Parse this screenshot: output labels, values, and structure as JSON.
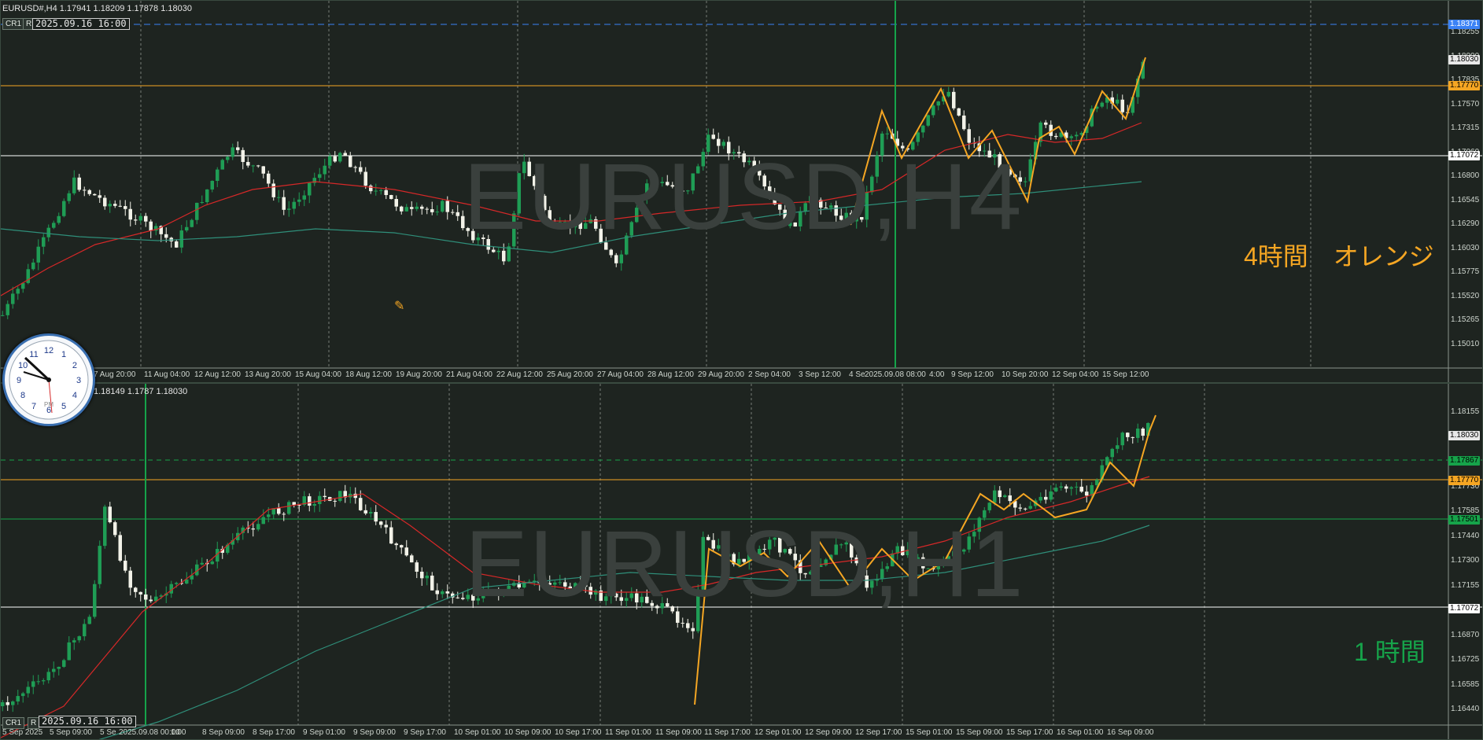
{
  "top_pane": {
    "title": "EURUSD#,H4  1.17941  1.18209  1.17878  1.18030",
    "btn_cr1": "CR1",
    "btn_r": "R",
    "cursor_date": "2025.09.16 16:00",
    "watermark": "EURUSD,H4",
    "overlay_text": "4時間　オレンジ",
    "overlay_color": "#f5a623",
    "x_labels": [
      "7 Aug 20:00",
      "11 Aug 04:00",
      "12 Aug 12:00",
      "13 Aug 20:00",
      "15 Aug 04:00",
      "18 Aug 12:00",
      "19 Aug 20:00",
      "21 Aug 04:00",
      "22 Aug 12:00",
      "25 Aug 20:00",
      "27 Aug 04:00",
      "28 Aug 12:00",
      "29 Aug 20:00",
      "2 Sep 04:00",
      "3 Sep 12:00",
      "4 Se",
      "2025.09.08 08:00",
      "4:00",
      "9 Sep 12:00",
      "10 Sep 20:00",
      "12 Sep 04:00",
      "15 Sep 12:00"
    ],
    "y_labels": [
      "1.18255",
      "1.18000",
      "1.17835",
      "1.17570",
      "1.17315",
      "1.17060",
      "1.16800",
      "1.16545",
      "1.16290",
      "1.16030",
      "1.15775",
      "1.15520",
      "1.15265",
      "1.15010"
    ],
    "price_tags": {
      "blue": "1.18371",
      "current": "1.18030",
      "orange": "1.17770",
      "white": "1.17072"
    }
  },
  "bottom_pane": {
    "title": "1.18149  1.1787  1.18030",
    "btn_cr1": "CR1",
    "btn_r": "R",
    "cursor_date": "2025.09.16 16:00",
    "watermark": "EURUSD,H1",
    "overlay_text": "1 時間",
    "overlay_color": "#16a34a",
    "x_labels": [
      "5 Sep 2025",
      "5 Sep 09:00",
      "5 Se",
      "2025.09.08 00:00",
      "1:00",
      "8 Sep 09:00",
      "8 Sep 17:00",
      "9 Sep 01:00",
      "9 Sep 09:00",
      "9 Sep 17:00",
      "10 Sep 01:00",
      "10 Sep 09:00",
      "10 Sep 17:00",
      "11 Sep 01:00",
      "11 Sep 09:00",
      "11 Sep 17:00",
      "12 Sep 01:00",
      "12 Sep 09:00",
      "12 Sep 17:00",
      "15 Sep 01:00",
      "15 Sep 09:00",
      "15 Sep 17:00",
      "16 Sep 01:00",
      "16 Sep 09:00"
    ],
    "y_labels": [
      "1.18155",
      "1.18015",
      "1.17870",
      "1.17730",
      "1.17585",
      "1.17440",
      "1.17300",
      "1.17155",
      "1.17015",
      "1.16870",
      "1.16725",
      "1.16585",
      "1.16440"
    ],
    "price_tags": {
      "current": "1.18030",
      "green_dash": "1.17867",
      "orange": "1.17770",
      "green_solid": "1.17501",
      "white": "1.17072"
    }
  },
  "clock": {
    "numerals": [
      "12",
      "1",
      "2",
      "3",
      "4",
      "5",
      "6",
      "7",
      "8",
      "9",
      "10",
      "11"
    ],
    "ampm": "PM"
  },
  "colors": {
    "background": "#1e2420",
    "bull_candle": "#1f9d55",
    "bear_candle": "#f2f2e8",
    "ma_red": "#d62828",
    "ma_teal": "#2f8f7a",
    "zigzag": "#f5a623",
    "orange_line": "#f5a623",
    "white_line": "#ffffff",
    "blue_dash": "#3b82f6",
    "green_vline": "#16a34a"
  },
  "icons": {
    "cursor": "crosshair-pencil-icon",
    "clock": "analog-clock-icon"
  }
}
